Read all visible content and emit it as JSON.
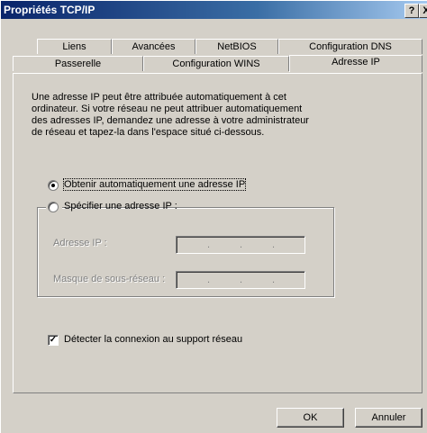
{
  "window": {
    "title": "Propriétés TCP/IP",
    "help_glyph": "?",
    "close_glyph": "X"
  },
  "tabs": {
    "row1": [
      "Liens",
      "Avancées",
      "NetBIOS",
      "Configuration DNS"
    ],
    "row2": [
      "Passerelle",
      "Configuration WINS",
      "Adresse IP"
    ],
    "active": "Adresse IP"
  },
  "panel": {
    "intro": "Une adresse IP peut être attribuée automatiquement à cet\nordinateur. Si votre réseau ne peut attribuer automatiquement\ndes adresses IP, demandez une adresse à votre administrateur\nde réseau et tapez-la dans l'espace situé ci-dessous.",
    "option_auto": "Obtenir automatiquement une adresse IP",
    "option_manual": "Spécifier une adresse IP :",
    "selected_option": "option_auto",
    "ip_label": "Adresse IP :",
    "mask_label": "Masque de sous-réseau :",
    "ip_value": [
      "",
      "",
      "",
      ""
    ],
    "mask_value": [
      "",
      "",
      "",
      ""
    ],
    "detect_label": "Détecter la connexion au support réseau",
    "detect_checked": true
  },
  "buttons": {
    "ok": "OK",
    "cancel": "Annuler"
  },
  "colors": {
    "face": "#d4d0c8",
    "title_start": "#0a246a",
    "title_end": "#a6caf0"
  }
}
